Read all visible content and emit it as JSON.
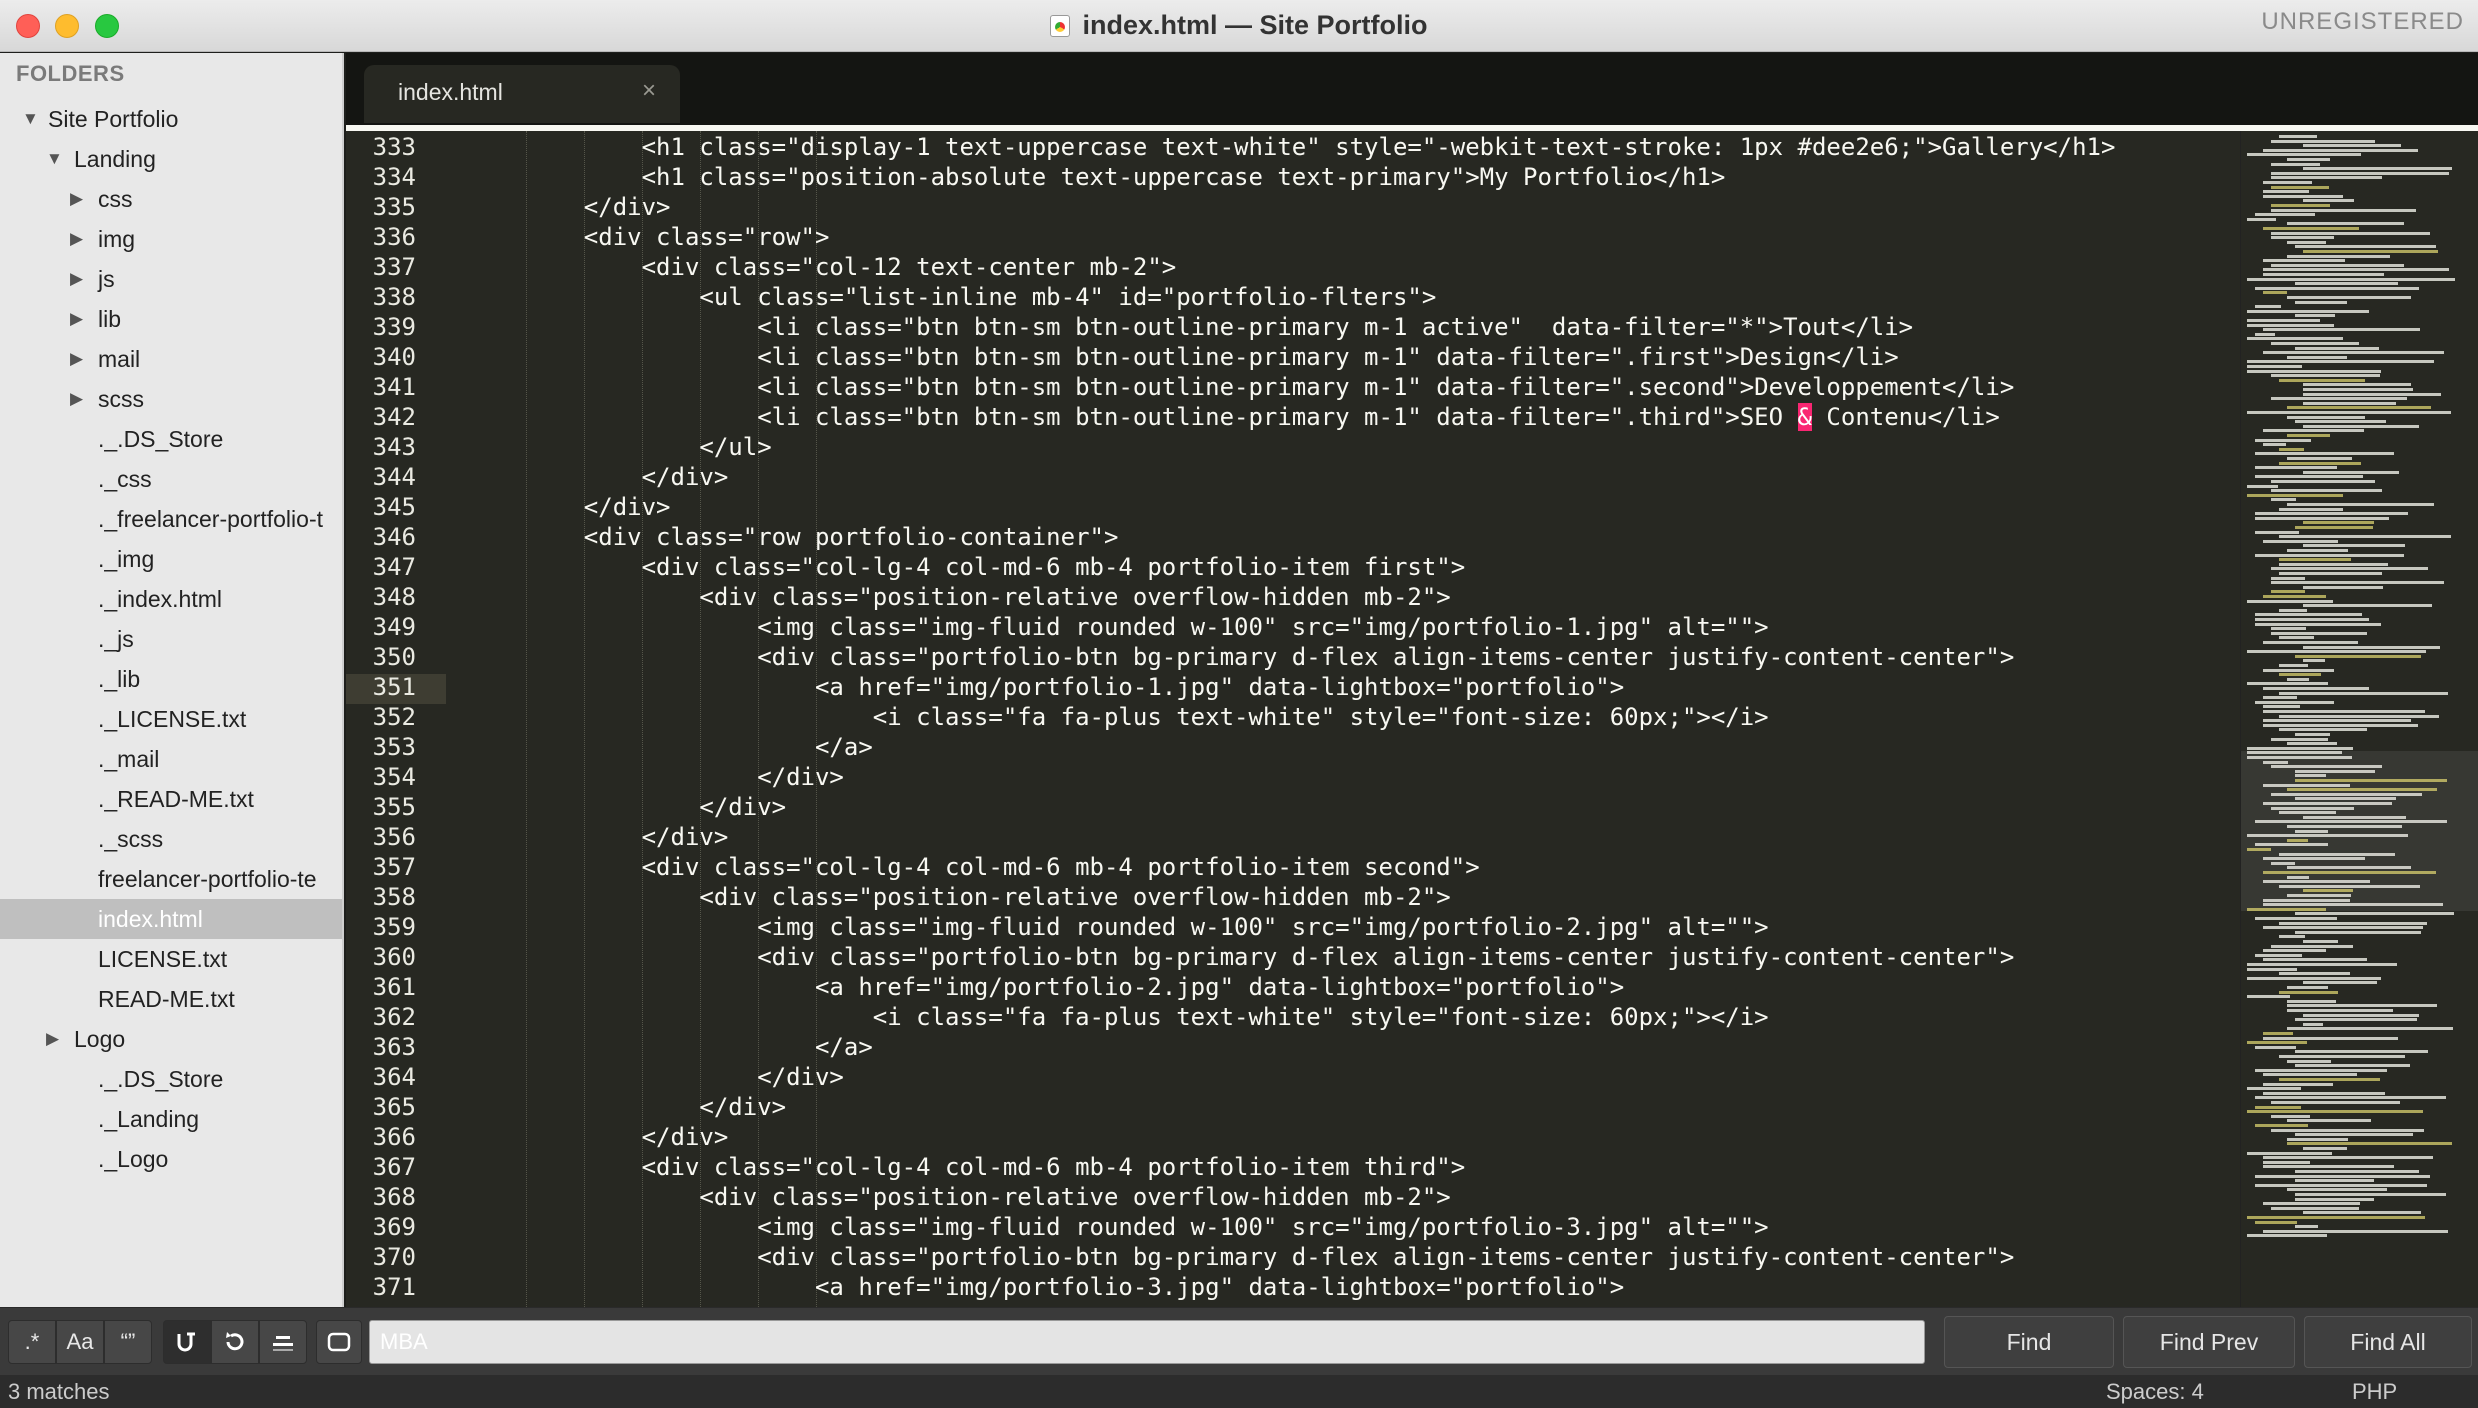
{
  "window": {
    "title": "index.html — Site Portfolio",
    "registration": "UNREGISTERED"
  },
  "sidebar": {
    "heading": "FOLDERS",
    "items": [
      {
        "label": "Site Portfolio",
        "arrow": "▼",
        "depth": 0,
        "selected": false
      },
      {
        "label": "Landing",
        "arrow": "▼",
        "depth": 1,
        "selected": false
      },
      {
        "label": "css",
        "arrow": "▶",
        "depth": 2,
        "selected": false
      },
      {
        "label": "img",
        "arrow": "▶",
        "depth": 2,
        "selected": false
      },
      {
        "label": "js",
        "arrow": "▶",
        "depth": 2,
        "selected": false
      },
      {
        "label": "lib",
        "arrow": "▶",
        "depth": 2,
        "selected": false
      },
      {
        "label": "mail",
        "arrow": "▶",
        "depth": 2,
        "selected": false
      },
      {
        "label": "scss",
        "arrow": "▶",
        "depth": 2,
        "selected": false
      },
      {
        "label": "._.DS_Store",
        "arrow": "",
        "depth": 3,
        "selected": false
      },
      {
        "label": "._css",
        "arrow": "",
        "depth": 3,
        "selected": false
      },
      {
        "label": "._freelancer-portfolio-t",
        "arrow": "",
        "depth": 3,
        "selected": false
      },
      {
        "label": "._img",
        "arrow": "",
        "depth": 3,
        "selected": false
      },
      {
        "label": "._index.html",
        "arrow": "",
        "depth": 3,
        "selected": false
      },
      {
        "label": "._js",
        "arrow": "",
        "depth": 3,
        "selected": false
      },
      {
        "label": "._lib",
        "arrow": "",
        "depth": 3,
        "selected": false
      },
      {
        "label": "._LICENSE.txt",
        "arrow": "",
        "depth": 3,
        "selected": false
      },
      {
        "label": "._mail",
        "arrow": "",
        "depth": 3,
        "selected": false
      },
      {
        "label": "._READ-ME.txt",
        "arrow": "",
        "depth": 3,
        "selected": false
      },
      {
        "label": "._scss",
        "arrow": "",
        "depth": 3,
        "selected": false
      },
      {
        "label": "freelancer-portfolio-te",
        "arrow": "",
        "depth": 3,
        "selected": false
      },
      {
        "label": "index.html",
        "arrow": "",
        "depth": 3,
        "selected": true
      },
      {
        "label": "LICENSE.txt",
        "arrow": "",
        "depth": 3,
        "selected": false
      },
      {
        "label": "READ-ME.txt",
        "arrow": "",
        "depth": 3,
        "selected": false
      },
      {
        "label": "Logo",
        "arrow": "▶",
        "depth": 1,
        "selected": false
      },
      {
        "label": "._.DS_Store",
        "arrow": "",
        "depth": 2,
        "selected": false
      },
      {
        "label": "._Landing",
        "arrow": "",
        "depth": 2,
        "selected": false
      },
      {
        "label": "._Logo",
        "arrow": "",
        "depth": 2,
        "selected": false
      }
    ]
  },
  "tab": {
    "label": "index.html",
    "close": "×"
  },
  "editor": {
    "current_line": 351,
    "lines": [
      {
        "n": "333",
        "t": "        <h1 class=\"display-1 text-uppercase text-white\" style=\"-webkit-text-stroke: 1px #dee2e6;\">Gallery</h1>"
      },
      {
        "n": "334",
        "t": "        <h1 class=\"position-absolute text-uppercase text-primary\">My Portfolio</h1>"
      },
      {
        "n": "335",
        "t": "    </div>"
      },
      {
        "n": "336",
        "t": "    <div class=\"row\">"
      },
      {
        "n": "337",
        "t": "        <div class=\"col-12 text-center mb-2\">"
      },
      {
        "n": "338",
        "t": "            <ul class=\"list-inline mb-4\" id=\"portfolio-flters\">"
      },
      {
        "n": "339",
        "t": "                <li class=\"btn btn-sm btn-outline-primary m-1 active\"  data-filter=\"*\">Tout</li>"
      },
      {
        "n": "340",
        "t": "                <li class=\"btn btn-sm btn-outline-primary m-1\" data-filter=\".first\">Design</li>"
      },
      {
        "n": "341",
        "t": "                <li class=\"btn btn-sm btn-outline-primary m-1\" data-filter=\".second\">Developpement</li>"
      },
      {
        "n": "342",
        "t": "                <li class=\"btn btn-sm btn-outline-primary m-1\" data-filter=\".third\">SEO & Contenu</li>"
      },
      {
        "n": "343",
        "t": "            </ul>"
      },
      {
        "n": "344",
        "t": "        </div>"
      },
      {
        "n": "345",
        "t": "    </div>"
      },
      {
        "n": "346",
        "t": "    <div class=\"row portfolio-container\">"
      },
      {
        "n": "347",
        "t": "        <div class=\"col-lg-4 col-md-6 mb-4 portfolio-item first\">"
      },
      {
        "n": "348",
        "t": "            <div class=\"position-relative overflow-hidden mb-2\">"
      },
      {
        "n": "349",
        "t": "                <img class=\"img-fluid rounded w-100\" src=\"img/portfolio-1.jpg\" alt=\"\">"
      },
      {
        "n": "350",
        "t": "                <div class=\"portfolio-btn bg-primary d-flex align-items-center justify-content-center\">"
      },
      {
        "n": "351",
        "t": "                    <a href=\"img/portfolio-1.jpg\" data-lightbox=\"portfolio\">"
      },
      {
        "n": "352",
        "t": "                        <i class=\"fa fa-plus text-white\" style=\"font-size: 60px;\"></i>"
      },
      {
        "n": "353",
        "t": "                    </a>"
      },
      {
        "n": "354",
        "t": "                </div>"
      },
      {
        "n": "355",
        "t": "            </div>"
      },
      {
        "n": "356",
        "t": "        </div>"
      },
      {
        "n": "357",
        "t": "        <div class=\"col-lg-4 col-md-6 mb-4 portfolio-item second\">"
      },
      {
        "n": "358",
        "t": "            <div class=\"position-relative overflow-hidden mb-2\">"
      },
      {
        "n": "359",
        "t": "                <img class=\"img-fluid rounded w-100\" src=\"img/portfolio-2.jpg\" alt=\"\">"
      },
      {
        "n": "360",
        "t": "                <div class=\"portfolio-btn bg-primary d-flex align-items-center justify-content-center\">"
      },
      {
        "n": "361",
        "t": "                    <a href=\"img/portfolio-2.jpg\" data-lightbox=\"portfolio\">"
      },
      {
        "n": "362",
        "t": "                        <i class=\"fa fa-plus text-white\" style=\"font-size: 60px;\"></i>"
      },
      {
        "n": "363",
        "t": "                    </a>"
      },
      {
        "n": "364",
        "t": "                </div>"
      },
      {
        "n": "365",
        "t": "            </div>"
      },
      {
        "n": "366",
        "t": "        </div>"
      },
      {
        "n": "367",
        "t": "        <div class=\"col-lg-4 col-md-6 mb-4 portfolio-item third\">"
      },
      {
        "n": "368",
        "t": "            <div class=\"position-relative overflow-hidden mb-2\">"
      },
      {
        "n": "369",
        "t": "                <img class=\"img-fluid rounded w-100\" src=\"img/portfolio-3.jpg\" alt=\"\">"
      },
      {
        "n": "370",
        "t": "                <div class=\"portfolio-btn bg-primary d-flex align-items-center justify-content-center\">"
      },
      {
        "n": "371",
        "t": "                    <a href=\"img/portfolio-3.jpg\" data-lightbox=\"portfolio\">"
      }
    ]
  },
  "findbar": {
    "regex_label": ".*",
    "case_label": "Aa",
    "word_label": "“”",
    "wrap_icon": "wrap-icon",
    "in_selection_icon": "in-selection-icon",
    "highlight_icon": "highlight-matches-icon",
    "context_icon": "show-context-icon",
    "search_value": "MBA",
    "find_label": "Find",
    "find_prev_label": "Find Prev",
    "find_all_label": "Find All"
  },
  "status": {
    "matches": "3 matches",
    "indent": "Spaces: 4",
    "syntax": "PHP"
  },
  "colors": {
    "editor_bg": "#272822",
    "text": "#f8f8f2",
    "highlight_amp": "#f92672",
    "sidebar_bg": "#e8e8e8"
  }
}
